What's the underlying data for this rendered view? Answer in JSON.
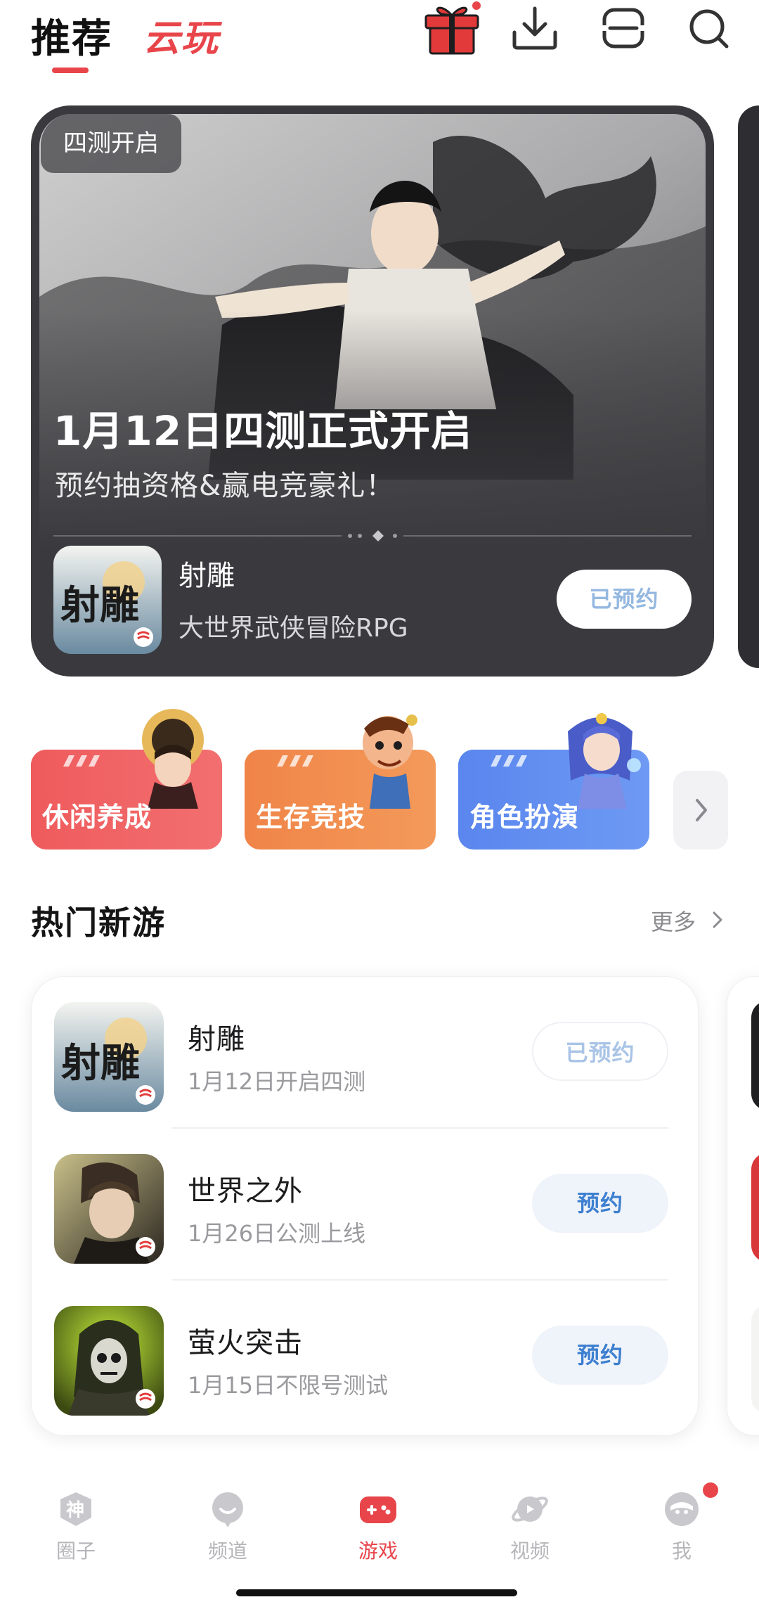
{
  "header": {
    "tab_recommend": "推荐",
    "tab_cloud": "云玩",
    "icons": [
      "gift-icon",
      "download-icon",
      "scan-icon",
      "search-icon"
    ],
    "accent": "#e8454a"
  },
  "banner": {
    "badge": "四测开启",
    "title": "1月12日四测正式开启",
    "subtitle": "预约抽资格&赢电竞豪礼！",
    "app_name": "射雕",
    "app_desc": "大世界武侠冒险RPG",
    "button": "已预约",
    "icon_text": "射雕"
  },
  "categories": [
    {
      "label": "休闲养成",
      "color": "#ee5a5c"
    },
    {
      "label": "生存竞技",
      "color": "#f2894a"
    },
    {
      "label": "角色扮演",
      "color": "#5b8df0"
    }
  ],
  "hot_section": {
    "title": "热门新游",
    "more": "更多",
    "games": [
      {
        "name": "射雕",
        "desc": "1月12日开启四测",
        "button": "已预约",
        "reserved": true,
        "icon_text": "射雕"
      },
      {
        "name": "世界之外",
        "desc": "1月26日公测上线",
        "button": "预约",
        "reserved": false
      },
      {
        "name": "萤火突击",
        "desc": "1月15日不限号测试",
        "button": "预约",
        "reserved": false
      }
    ]
  },
  "bottom_nav": {
    "items": [
      {
        "label": "圈子",
        "icon": "shield-shen-icon"
      },
      {
        "label": "频道",
        "icon": "channel-bubble-icon"
      },
      {
        "label": "游戏",
        "icon": "gamepad-icon",
        "active": true
      },
      {
        "label": "视频",
        "icon": "planet-icon"
      },
      {
        "label": "我",
        "icon": "avatar-icon"
      }
    ]
  }
}
